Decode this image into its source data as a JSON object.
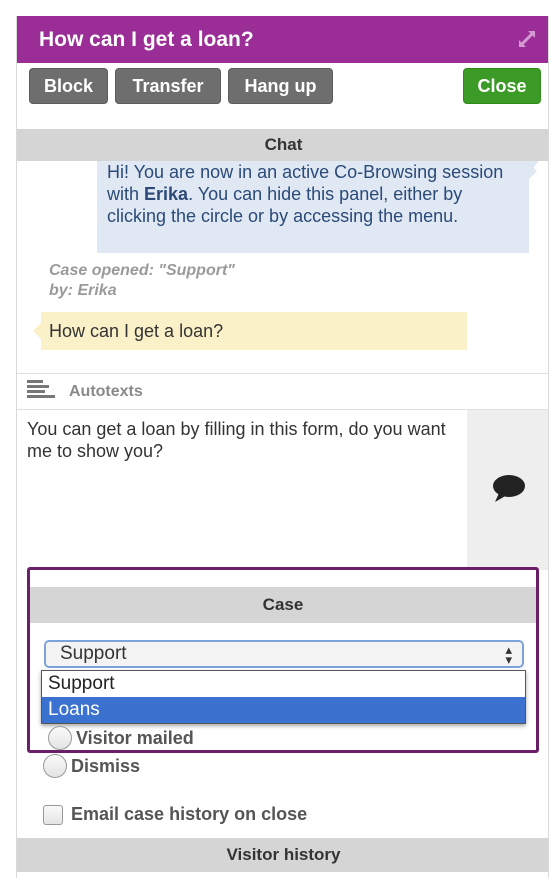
{
  "window": {
    "title": "How can I get a loan?",
    "expand_icon": "expand-icon"
  },
  "toolbar": {
    "block_label": "Block",
    "transfer_label": "Transfer",
    "hangup_label": "Hang up",
    "close_label": "Close"
  },
  "chat": {
    "section_label": "Chat",
    "system_message": {
      "before": "Hi! You are now in an active Co-Browsing session with ",
      "name": "Erika",
      "after": ". You can hide this panel, either by clicking the circle or by accessing the menu."
    },
    "case_opened_line1": "Case opened: \"Support\"",
    "case_opened_line2": "by: Erika",
    "visitor_message": "How can I get a loan?"
  },
  "autotexts": {
    "label": "Autotexts",
    "icon": "lines-icon"
  },
  "composer": {
    "value": "You can get a loan by filling in this form, do you want me to show you?",
    "send_icon": "speech-bubble-icon"
  },
  "case": {
    "section_label": "Case",
    "selected": "Support",
    "options": [
      "Support",
      "Loans"
    ],
    "highlighted_option": "Loans",
    "visitor_mailed_label": "Visitor mailed",
    "dismiss_label": "Dismiss",
    "email_history_label": "Email case history on close"
  },
  "visitor_history": {
    "section_label": "Visitor history"
  },
  "colors": {
    "title_bar": "#9b2d96",
    "close_button": "#3c9b26",
    "case_panel_border": "#6b1f66",
    "dropdown_highlight": "#3b72d0"
  }
}
